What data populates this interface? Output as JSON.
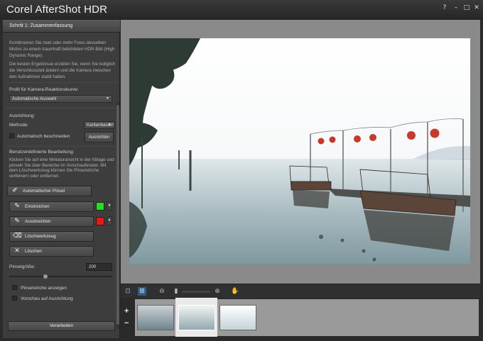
{
  "app": {
    "title": "Corel AfterShot HDR"
  },
  "window_controls": {
    "help": "?",
    "minimize": "–",
    "maximize": "□",
    "close": "✕"
  },
  "panel": {
    "step_title": "Schritt 1: Zusammenfassung",
    "intro_1": "Kombinieren Sie zwei oder mehr Fotos desselben Motivs zu einem traumhaft belichteten HDR-Bild (High Dynamic Range).",
    "intro_2": "Die besten Ergebnisse erzielen Sie, wenn Sie lediglich die Verschlusszeit ändern und die Kamera zwischen den Aufnahmen stabil halten.",
    "profile_label": "Profil für Kamera-Reaktionskurve:",
    "profile_value": "Automatische Auswahl",
    "align_label": "Ausrichtung:",
    "method_label": "Methode:",
    "method_value": "Kantenbasiert",
    "autocrop_label": "Automatisch beschneiden",
    "align_button": "Ausrichten",
    "custom_label": "Benutzerdefinierte Bearbeitung:",
    "custom_text": "Klicken Sie auf eine Miniaturansicht in der Ablage und pinseln Sie über Bereiche im Vorschaufenster. Mit dem Löschwerkzeug können Sie Pinselstriche verfeinern oder entfernen.",
    "auto_brush": "Automatischer Pinsel",
    "brush_in": "Einstreichen",
    "brush_out": "Ausstreichen",
    "eraser": "Löschwerkzeug",
    "delete": "Löschen",
    "brush_size_label": "Pinselgröße:",
    "brush_size_value": "200",
    "brush_size_fraction": 0.35,
    "show_strokes": "Pinselstriche anzeigen",
    "preview_align": "Vorschau auf Ausrichtung",
    "process_button": "Verarbeiten"
  },
  "colors": {
    "brush_in": "#22e01a",
    "brush_out": "#e41a1a"
  },
  "icons": {
    "fit": "fit-view-icon",
    "actual": "actual-size-icon",
    "zoom_out": "zoom-out-icon",
    "zoom_in": "zoom-in-icon",
    "pan": "hand-pan-icon"
  },
  "filmstrip": {
    "add": "+",
    "remove": "−",
    "thumbnail_count": 3,
    "selected_index": 1
  }
}
